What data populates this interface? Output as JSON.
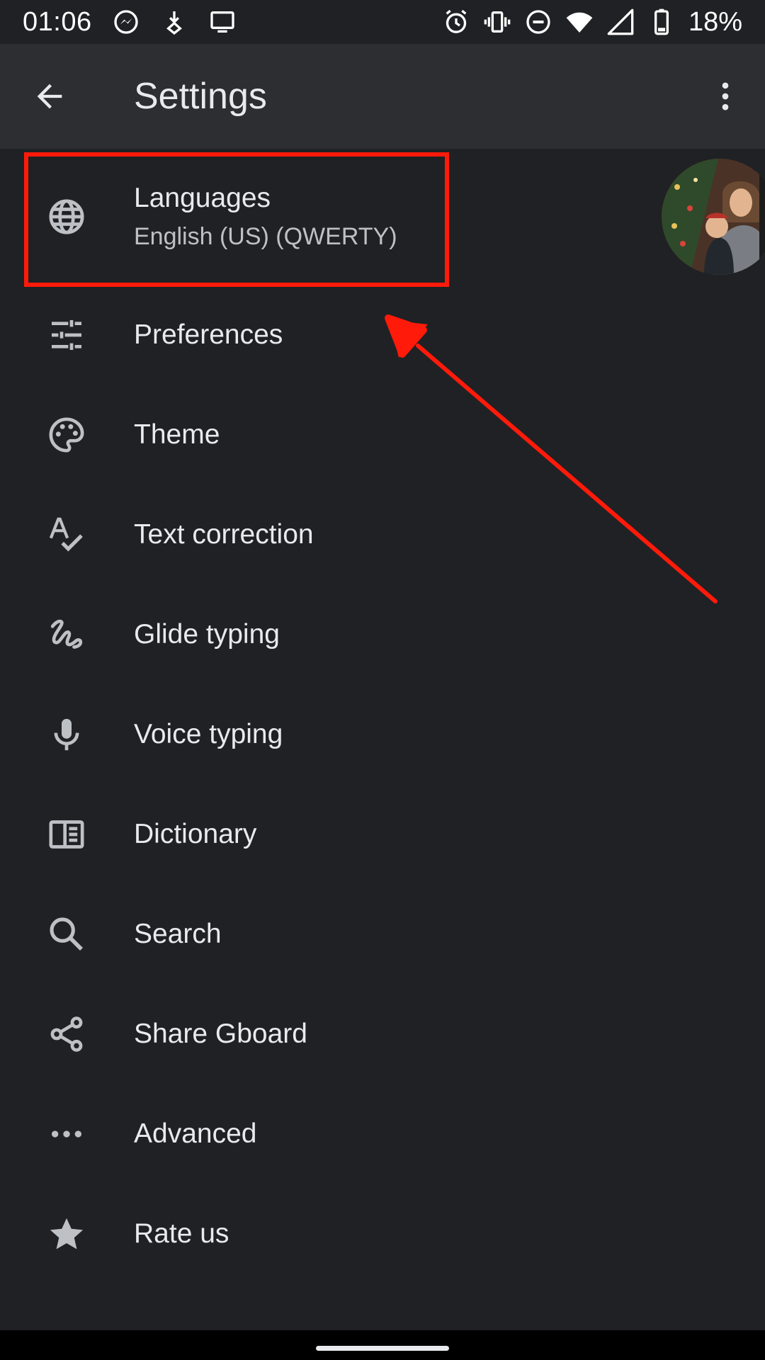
{
  "status_bar": {
    "time": "01:06",
    "battery_percent": "18%",
    "left_icons": [
      "messenger-icon",
      "download-icon",
      "cast-screen-icon"
    ],
    "right_icons": [
      "alarm-icon",
      "vibrate-icon",
      "do-not-disturb-icon",
      "wifi-icon",
      "cell-signal-icon",
      "battery-icon"
    ]
  },
  "app_bar": {
    "title": "Settings",
    "back_icon": "arrow-back-icon",
    "overflow_icon": "more-vert-icon"
  },
  "settings": {
    "items": [
      {
        "label": "Languages",
        "sublabel": "English (US) (QWERTY)",
        "icon": "globe-icon"
      },
      {
        "label": "Preferences",
        "icon": "tune-icon"
      },
      {
        "label": "Theme",
        "icon": "palette-icon"
      },
      {
        "label": "Text correction",
        "icon": "spellcheck-icon"
      },
      {
        "label": "Glide typing",
        "icon": "gesture-icon"
      },
      {
        "label": "Voice typing",
        "icon": "mic-icon"
      },
      {
        "label": "Dictionary",
        "icon": "dictionary-icon"
      },
      {
        "label": "Search",
        "icon": "search-icon"
      },
      {
        "label": "Share Gboard",
        "icon": "share-icon"
      },
      {
        "label": "Advanced",
        "icon": "more-horiz-icon"
      },
      {
        "label": "Rate us",
        "icon": "star-icon"
      }
    ]
  },
  "colors": {
    "background": "#202124",
    "app_bar": "#2d2e31",
    "text_primary": "#e8eaed",
    "text_secondary": "#bdc1c6",
    "icon": "#bdc1c6",
    "annotation": "#ff1a0a"
  }
}
